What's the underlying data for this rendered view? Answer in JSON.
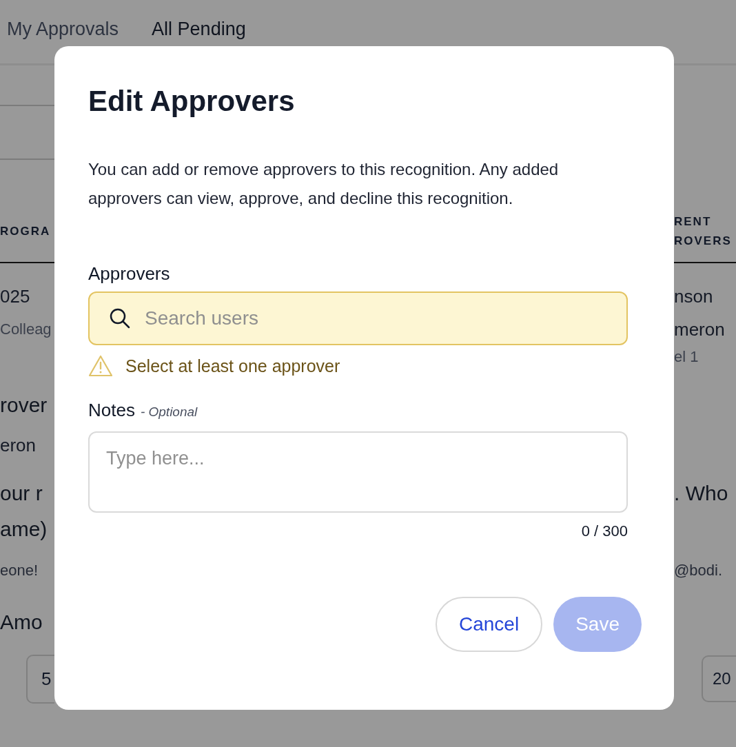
{
  "background": {
    "tabs": [
      {
        "label": "My Approvals",
        "selected": false
      },
      {
        "label": "All Pending",
        "selected": true
      }
    ],
    "rows": [
      {
        "left": {
          "kind": "header",
          "text": "ROGRA"
        },
        "right": {
          "kind": "header",
          "text": "RENT ROVERS"
        }
      },
      {
        "left": {
          "kind": "value",
          "text": "025"
        },
        "right": {
          "kind": "value",
          "text": "nson"
        }
      },
      {
        "left": {
          "kind": "sub",
          "text": "Colleag"
        },
        "right": {
          "kind": "value",
          "text": "meron"
        }
      },
      {
        "right": {
          "kind": "sub",
          "text": "el 1"
        }
      },
      {
        "left": {
          "kind": "heading",
          "text": "rover"
        }
      },
      {
        "left": {
          "kind": "value",
          "text": "eron"
        }
      },
      {
        "left": {
          "kind": "heading",
          "text": "our r"
        },
        "right": {
          "kind": "heading",
          "text": ". Who"
        }
      },
      {
        "left": {
          "kind": "heading",
          "text": "ame)"
        }
      },
      {
        "left": {
          "kind": "body",
          "text": "eone!"
        },
        "right": {
          "kind": "body",
          "text": "@bodi."
        }
      },
      {
        "left": {
          "kind": "heading",
          "text": "Amo"
        }
      },
      {
        "left": {
          "kind": "chip",
          "text": "5"
        },
        "right": {
          "kind": "chip",
          "text": "20"
        }
      }
    ]
  },
  "dialog": {
    "title": "Edit Approvers",
    "description": "You can add or remove approvers to this recognition. Any added approvers can view, approve, and decline this recognition.",
    "approvers": {
      "label": "Approvers",
      "placeholder": "Search users",
      "error": "Select at least one approver"
    },
    "notes": {
      "label": "Notes",
      "hint": "- Optional",
      "placeholder": "Type here...",
      "counter": "0 / 300"
    },
    "buttons": [
      {
        "label": "Cancel",
        "kind": "secondary",
        "disabled": false
      },
      {
        "label": "Save",
        "kind": "primary",
        "disabled": true
      }
    ]
  }
}
